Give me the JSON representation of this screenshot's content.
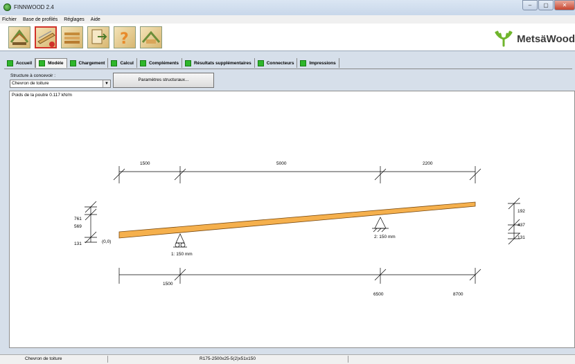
{
  "window": {
    "title": "FINNWOOD 2.4",
    "min": "–",
    "max": "▢",
    "close": "✕"
  },
  "menu": [
    "Fichier",
    "Base de profilés",
    "Réglages",
    "Aide"
  ],
  "toolbar": {
    "buttons": [
      "new-structure",
      "beam-model",
      "profiles-database",
      "export",
      "help",
      "settings"
    ],
    "logo_text": "MetsäWood"
  },
  "tabs": [
    {
      "label": "Accueil",
      "active": false
    },
    {
      "label": "Modèle",
      "active": true
    },
    {
      "label": "Chargement",
      "active": false
    },
    {
      "label": "Calcul",
      "active": false
    },
    {
      "label": "Compléments",
      "active": false
    },
    {
      "label": "Résultats supplémentaires",
      "active": false
    },
    {
      "label": "Connecteurs",
      "active": false
    },
    {
      "label": "Impressions",
      "active": false
    }
  ],
  "structure": {
    "label": "Structure à concevoir :",
    "value": "Chevron de toiture",
    "param_button": "Paramètres structuraux..."
  },
  "canvas": {
    "beam_weight": "Poids de la poutre 0.117 kN/m",
    "top_dims": [
      "1500",
      "5000",
      "2200"
    ],
    "bottom_dims": [
      "1500",
      "6500",
      "8700"
    ],
    "left_heights": [
      "761",
      "569",
      "131"
    ],
    "right_heights": [
      "192",
      "437",
      "131"
    ],
    "origin": "(0,0)",
    "support1": "1: 150 mm",
    "support2": "2: 150 mm"
  },
  "colors": {
    "beam": "#f5b04d",
    "tab_square": "#2fb62b",
    "canvas_bg": "#ffffff"
  },
  "status": {
    "left": "Chevron de toiture",
    "mid": "R175-2500x25-5(2)x51x150"
  }
}
